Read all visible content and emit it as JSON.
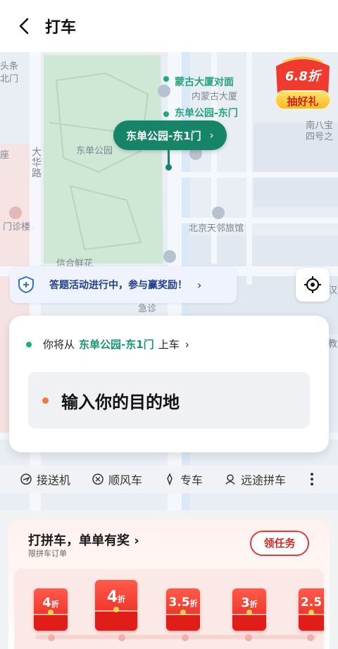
{
  "header": {
    "title": "打车"
  },
  "map": {
    "labels": {
      "park": "东单公园",
      "road_vertical": "大华路",
      "hotel": "北京天邻旅馆",
      "topleft": "头条\n北门",
      "clinic": "门诊楼",
      "left_edge": "座",
      "poi_1": "蒙古大厦对面",
      "poi_1_sub": "内蒙古大厦",
      "poi_2": "东单公园-东门",
      "bottom_store": "信合鲜花",
      "jizhen": "急诊",
      "right_a": "南八宝",
      "right_b": "四号之",
      "right_c": "汉",
      "right_d": "教"
    },
    "pickup_bubble": "东单公园-东1门"
  },
  "promo": {
    "discount": "6.8折",
    "label": "抽好礼"
  },
  "quiz_banner": {
    "text": "答题活动进行中，参与赢奖励！"
  },
  "trip": {
    "from_prefix": "你将从",
    "from_place": "东单公园-东1门",
    "from_suffix": "上车",
    "destination_placeholder": "输入你的目的地"
  },
  "services": [
    {
      "label": "接送机",
      "icon": "airport-icon"
    },
    {
      "label": "顺风车",
      "icon": "hitch-icon"
    },
    {
      "label": "专车",
      "icon": "premium-car-icon"
    },
    {
      "label": "远途拼车",
      "icon": "carpool-icon"
    }
  ],
  "reward": {
    "title": "打拼车，单单有奖",
    "subtitle": "限拼车订单",
    "task_button": "领任务",
    "coupons": [
      {
        "value": "4",
        "unit": "折"
      },
      {
        "value": "4",
        "unit": "折"
      },
      {
        "value": "3.5",
        "unit": "折"
      },
      {
        "value": "3",
        "unit": "折"
      },
      {
        "value": "2.5",
        "unit": ""
      }
    ]
  },
  "colors": {
    "accent_green": "#158467",
    "brand_red": "#e43b36",
    "quiz_blue": "#23408e"
  }
}
